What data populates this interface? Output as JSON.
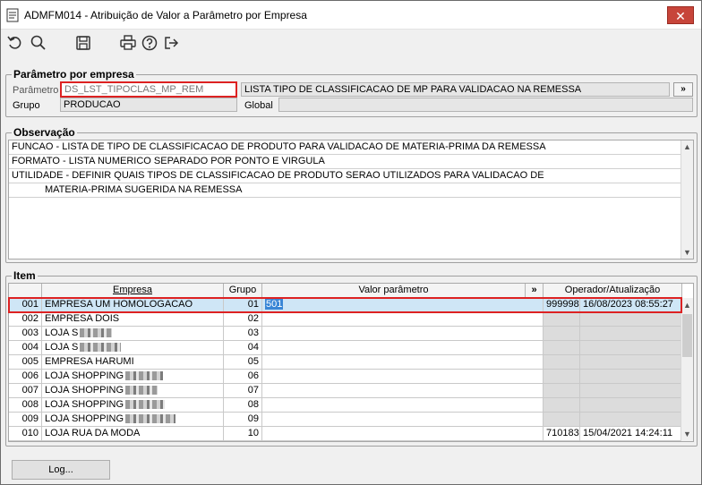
{
  "window": {
    "title": "ADMFM014 - Atribuição de Valor a Parâmetro por Empresa",
    "close_label": "✕"
  },
  "toolbar": {
    "icons": [
      "undo-icon",
      "search-icon",
      "save-icon",
      "print-icon",
      "help-icon",
      "exit-icon"
    ]
  },
  "parametro": {
    "group_title": "Parâmetro por empresa",
    "parametro_label": "Parâmetro",
    "parametro_code": "DS_LST_TIPOCLAS_MP_REM",
    "parametro_desc": "LISTA TIPO DE CLASSIFICACAO DE MP PARA VALIDACAO NA REMESSA",
    "more_label": "»",
    "grupo_label": "Grupo",
    "grupo_value": "PRODUCAO",
    "global_label": "Global",
    "global_value": ""
  },
  "observacao": {
    "group_title": "Observação",
    "lines": [
      "FUNCAO - LISTA DE TIPO DE CLASSIFICACAO DE PRODUTO PARA VALIDACAO DE MATERIA-PRIMA DA REMESSA",
      "FORMATO - LISTA NUMERICO SEPARADO POR PONTO E VIRGULA",
      "UTILIDADE - DEFINIR QUAIS TIPOS DE CLASSIFICACAO DE PRODUTO SERAO UTILIZADOS PARA VALIDACAO DE",
      "MATERIA-PRIMA SUGERIDA NA REMESSA"
    ]
  },
  "item": {
    "group_title": "Item",
    "headers": {
      "empresa": "Empresa",
      "grupo": "Grupo",
      "valor": "Valor parâmetro",
      "more": "»",
      "operador": "Operador/Atualização"
    },
    "rows": [
      {
        "code": "001",
        "name": "EMPRESA UM HOMOLOGACAO",
        "group": "01",
        "value": "501",
        "operator": "999998",
        "updated": "16/08/2023 08:55:27",
        "masked": false
      },
      {
        "code": "002",
        "name": "EMPRESA DOIS",
        "group": "02",
        "value": "",
        "operator": "",
        "updated": "",
        "masked": false
      },
      {
        "code": "003",
        "name": "LOJA S",
        "group": "03",
        "value": "",
        "operator": "",
        "updated": "",
        "masked": true
      },
      {
        "code": "004",
        "name": "LOJA S",
        "group": "04",
        "value": "",
        "operator": "",
        "updated": "",
        "masked": true
      },
      {
        "code": "005",
        "name": "EMPRESA HARUMI",
        "group": "05",
        "value": "",
        "operator": "",
        "updated": "",
        "masked": false
      },
      {
        "code": "006",
        "name": "LOJA SHOPPING",
        "group": "06",
        "value": "",
        "operator": "",
        "updated": "",
        "masked": true
      },
      {
        "code": "007",
        "name": "LOJA SHOPPING",
        "group": "07",
        "value": "",
        "operator": "",
        "updated": "",
        "masked": true
      },
      {
        "code": "008",
        "name": "LOJA SHOPPING",
        "group": "08",
        "value": "",
        "operator": "",
        "updated": "",
        "masked": true
      },
      {
        "code": "009",
        "name": "LOJA SHOPPING",
        "group": "09",
        "value": "",
        "operator": "",
        "updated": "",
        "masked": true
      },
      {
        "code": "010",
        "name": "LOJA RUA DA MODA",
        "group": "10",
        "value": "",
        "operator": "710183",
        "updated": "15/04/2021 14:24:11",
        "masked": false
      }
    ]
  },
  "footer": {
    "log_label": "Log..."
  }
}
